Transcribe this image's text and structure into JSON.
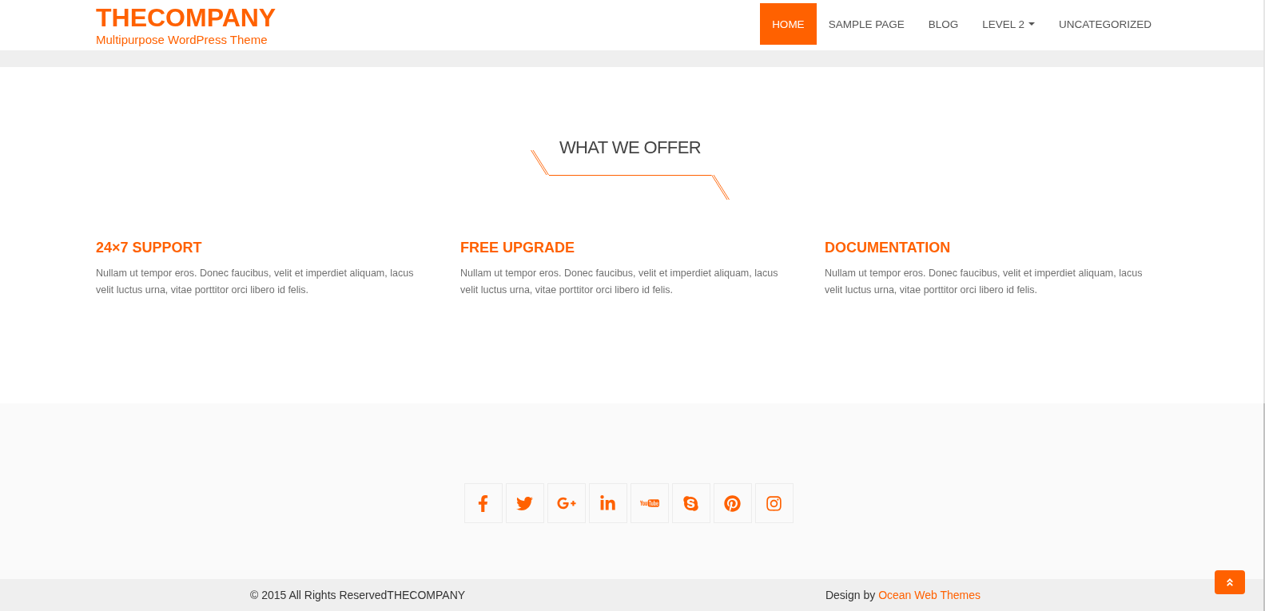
{
  "site": {
    "title": "THECOMPANY",
    "tagline": "Multipurpose WordPress Theme"
  },
  "nav": {
    "items": [
      {
        "label": "HOME",
        "selected": true,
        "dropdown": false
      },
      {
        "label": "SAMPLE PAGE",
        "selected": false,
        "dropdown": false
      },
      {
        "label": "BLOG",
        "selected": false,
        "dropdown": false
      },
      {
        "label": "LEVEL 2",
        "selected": false,
        "dropdown": true
      },
      {
        "label": "UNCATEGORIZED",
        "selected": false,
        "dropdown": false
      }
    ]
  },
  "offer": {
    "heading": "WHAT WE OFFER",
    "features": [
      {
        "title": "24×7 SUPPORT",
        "text": "Nullam ut tempor eros. Donec faucibus, velit et imperdiet aliquam, lacus velit luctus urna, vitae porttitor orci libero id felis."
      },
      {
        "title": "FREE UPGRADE",
        "text": "Nullam ut tempor eros. Donec faucibus, velit et imperdiet aliquam, lacus velit luctus urna, vitae porttitor orci libero id felis."
      },
      {
        "title": "DOCUMENTATION",
        "text": "Nullam ut tempor eros. Donec faucibus, velit et imperdiet aliquam, lacus velit luctus urna, vitae porttitor orci libero id felis."
      }
    ]
  },
  "social_links": [
    {
      "kind": "facebook"
    },
    {
      "kind": "twitter"
    },
    {
      "kind": "googleplus"
    },
    {
      "kind": "linkedin"
    },
    {
      "kind": "youtube"
    },
    {
      "kind": "skype"
    },
    {
      "kind": "pinterest"
    },
    {
      "kind": "instagram"
    }
  ],
  "footer": {
    "copyright": "© 2015 All Rights ReservedTHECOMPANY",
    "credit": {
      "text": "Design by",
      "link": "Ocean Web Themes"
    }
  }
}
